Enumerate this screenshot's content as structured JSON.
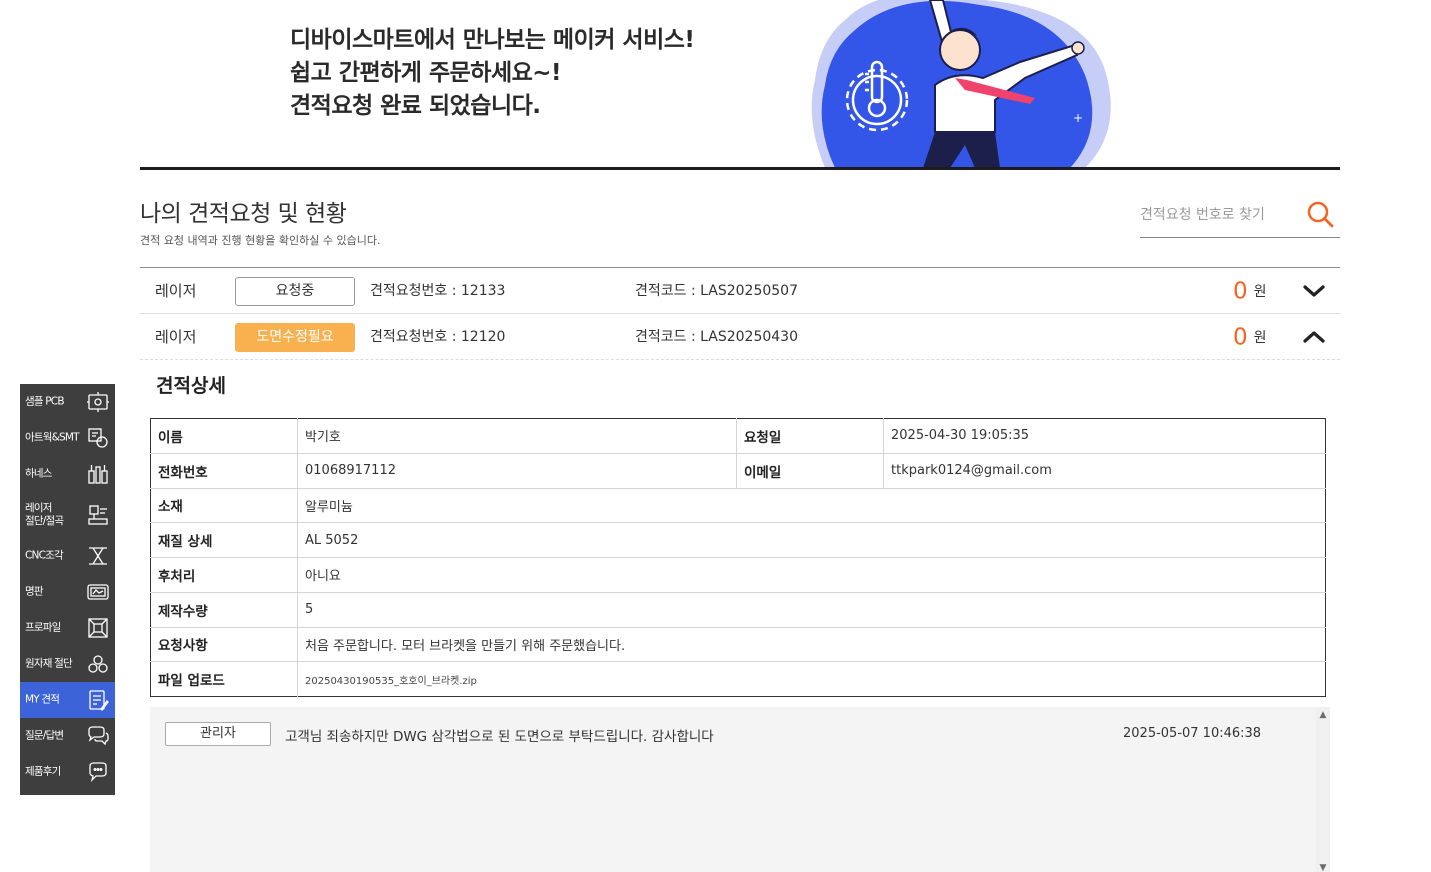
{
  "hero": {
    "lines": [
      "디바이스마트에서 만나보는 메이커 서비스!",
      "쉽고 간편하게 주문하세요~!",
      "견적요청 완료 되었습니다."
    ]
  },
  "header": {
    "title": "나의 견적요청 및 현황",
    "description": "견적 요청 내역과 진행 현황을 확인하실 수 있습니다.",
    "search_placeholder": "견적요청 번호로 찾기"
  },
  "requests": [
    {
      "category": "레이저",
      "status": "요청중",
      "request_number": "견적요청번호 : 12133",
      "quote_code": "견적코드 : LAS20250507",
      "price": "0",
      "currency": "원",
      "expanded": false
    },
    {
      "category": "레이저",
      "status": "도면수정필요",
      "request_number": "견적요청번호 : 12120",
      "quote_code": "견적코드 : LAS20250430",
      "price": "0",
      "currency": "원",
      "expanded": true
    }
  ],
  "detail": {
    "heading": "견적상세",
    "name_label": "이름",
    "name": "박기호",
    "request_date_label": "요청일",
    "request_date": "2025-04-30 19:05:35",
    "phone_label": "전화번호",
    "phone": "01068917112",
    "email_label": "이메일",
    "email": "ttkpark0124@gmail.com",
    "material_label": "소재",
    "material": "알루미늄",
    "material_detail_label": "재질 상세",
    "material_detail": "AL 5052",
    "post_process_label": "후처리",
    "post_process": "아니요",
    "quantity_label": "제작수량",
    "quantity": "5",
    "request_note_label": "요청사항",
    "request_note": "처음 주문합니다. 모터 브라켓을 만들기 위해 주문했습니다.",
    "file_label": "파일 업로드",
    "file": "20250430190535_호호이_브라켓.zip"
  },
  "comments": [
    {
      "author": "관리자",
      "text": "고객님 죄송하지만 DWG 삼각법으로 된 도면으로 부탁드립니다. 감사합니다",
      "time": "2025-05-07 10:46:38"
    }
  ],
  "sidenav": {
    "items": [
      {
        "label": "샘플 PCB",
        "icon": "pcb-icon"
      },
      {
        "label": "아트웍&SMT",
        "icon": "artwork-smt-icon"
      },
      {
        "label": "하네스",
        "icon": "harness-icon"
      },
      {
        "label": "레이저\n절단/절곡",
        "icon": "laser-cut-icon"
      },
      {
        "label": "CNC조각",
        "icon": "cnc-icon"
      },
      {
        "label": "명판",
        "icon": "nameplate-icon"
      },
      {
        "label": "프로파일",
        "icon": "profile-icon"
      },
      {
        "label": "원자재 절단",
        "icon": "raw-material-icon"
      },
      {
        "label": "MY 견적",
        "icon": "my-quote-icon",
        "active": true
      },
      {
        "label": "질문/답변",
        "icon": "qna-icon"
      },
      {
        "label": "제품후기",
        "icon": "review-icon"
      }
    ]
  },
  "colors": {
    "accent_orange": "#f26522",
    "badge_revise": "#f9b04f",
    "nav_active": "#3d63d8",
    "nav_bg": "#3e3e3e",
    "hero_blue": "#3355e8"
  }
}
